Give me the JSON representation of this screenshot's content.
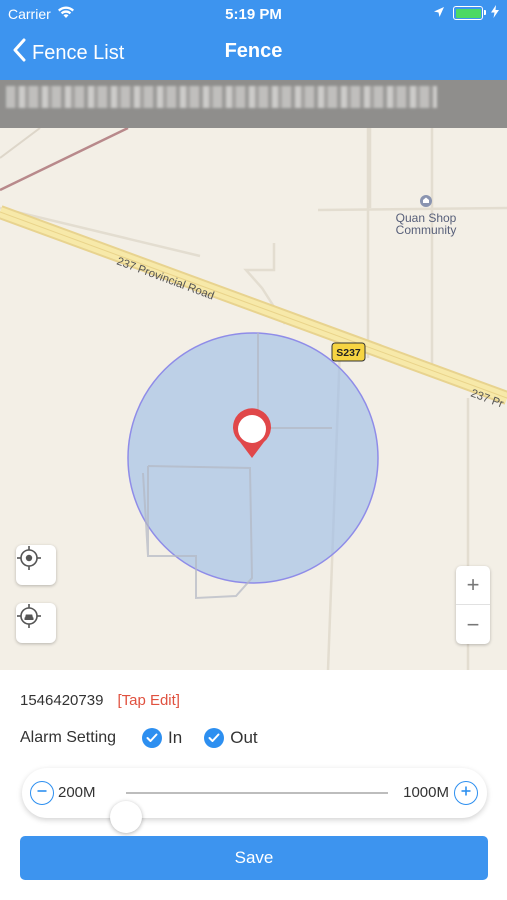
{
  "status_bar": {
    "carrier": "Carrier",
    "time": "5:19 PM",
    "icons": [
      "wifi-icon",
      "location-arrow-icon",
      "battery-icon",
      "charging-icon"
    ]
  },
  "nav": {
    "back_label": "Fence List",
    "title": "Fence"
  },
  "map": {
    "poi_name_line1": "Quan Shop",
    "poi_name_line2": "Community",
    "road_name": "237 Provincial Road",
    "road_name_right": "237 Pr",
    "road_badge": "S237",
    "fence_color": "#9fbfe8",
    "zoom_in": "+",
    "zoom_out": "−"
  },
  "device": {
    "id": "1546420739",
    "edit_label": "[Tap Edit]"
  },
  "alarm": {
    "label": "Alarm Setting",
    "options": [
      {
        "label": "In",
        "checked": true
      },
      {
        "label": "Out",
        "checked": true
      }
    ]
  },
  "radius": {
    "min_label": "200M",
    "max_label": "1000M",
    "value_fraction": 0.0
  },
  "save_label": "Save",
  "colors": {
    "accent": "#3d94ef",
    "edit": "#e0513f"
  }
}
